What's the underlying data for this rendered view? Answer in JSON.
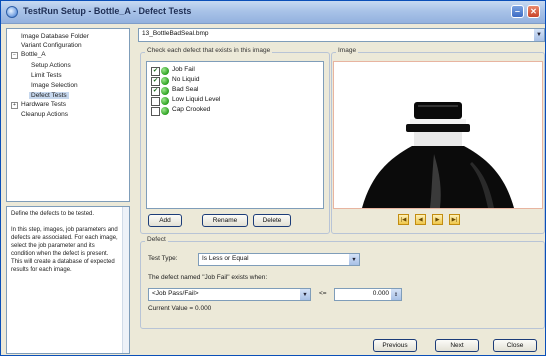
{
  "window": {
    "title": "TestRun Setup - Bottle_A - Defect Tests"
  },
  "tree": [
    {
      "label": "Image Database Folder"
    },
    {
      "label": "Variant Configuration"
    },
    {
      "label": "Bottle_A"
    },
    {
      "label": "Setup Actions"
    },
    {
      "label": "Limit Tests"
    },
    {
      "label": "Image Selection"
    },
    {
      "label": "Defect Tests"
    },
    {
      "label": "Hardware Tests"
    },
    {
      "label": "Cleanup Actions"
    }
  ],
  "help": {
    "p1": "Define the defects to be tested.",
    "p2": "In this step, images, job parameters and defects are associated. For each image, select the job parameter and its condition when the defect is present. This will create a database of expected results for each image."
  },
  "image_file": "13_BottleBadSeal.bmp",
  "defects_group": {
    "label": "Check each defect that exists in this image",
    "items": [
      {
        "label": "Job Fail",
        "checked": true
      },
      {
        "label": "No Liquid",
        "checked": true
      },
      {
        "label": "Bad Seal",
        "checked": true
      },
      {
        "label": "Low Liquid Level",
        "checked": false
      },
      {
        "label": "Cap Crooked",
        "checked": false
      }
    ]
  },
  "buttons": {
    "add": "Add",
    "rename": "Rename",
    "delete": "Delete",
    "previous": "Previous",
    "next": "Next",
    "close": "Close"
  },
  "image_group": {
    "label": "Image"
  },
  "defect": {
    "group_label": "Defect",
    "test_type_label": "Test Type:",
    "test_type_value": "Is Less or Equal",
    "condition_text": "The defect named \"Job Fail\" exists when:",
    "param_value": "<Job Pass/Fail>",
    "operator": "<=",
    "threshold": "0.000",
    "current_value": "Current Value = 0.000"
  },
  "colors": {
    "accent": "#0a4fb8",
    "titlebar": "#a9c3e8",
    "image_border": "#e8b4a0",
    "defect_dot": "#2aa01e"
  }
}
